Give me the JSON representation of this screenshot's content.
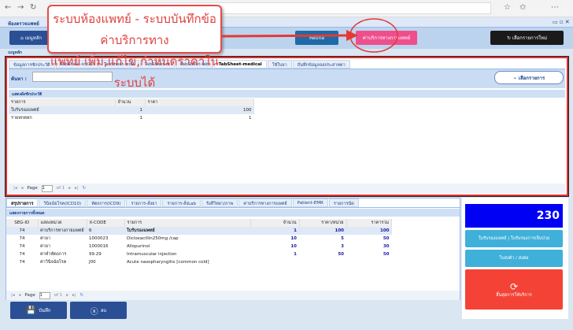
{
  "app": {
    "title": "ห้องตรวจแพทย์"
  },
  "toolbar": {
    "home": "เมนูหลัก",
    "retina": "Retina",
    "medical_fee": "ค่าบริการทางการแพทย์",
    "new_item": "เลือกรายการใหม่"
  },
  "menu_tab": "เมนูหลัก",
  "callout": {
    "line1": "ระบบห้องแพทย์ - ระบบบันทึกข้อค่าบริการทาง",
    "line2": "แพทย์ เพิ่ม,แก้ไข,กำหนดราคาในระบบได้"
  },
  "top_tabs": [
    "ข้อมูลการซักประวัติ",
    "TabSheet-icd10",
    "TabSheet-icd9",
    "TabSheet-rx",
    "TabSheet-lab",
    "TabSheet-medical",
    "ใช้ใบยา",
    "บันทึกข้อมูลจอประสาทตา"
  ],
  "search": {
    "label": "ค้นหา :",
    "value": "",
    "select_button": "เลือกรายการ"
  },
  "upper_grid": {
    "title": "แสดงผังซักประวัติ",
    "columns": [
      "รายการ",
      "จำนวน",
      "ราคา"
    ],
    "rows": [
      [
        "ใบรับรองแพทย์",
        "1",
        "100"
      ],
      [
        "รายหกตหก",
        "1",
        "1"
      ]
    ]
  },
  "pager": {
    "page_label": "Page",
    "page": "1",
    "of": "of 1"
  },
  "bottom_tabs": [
    "สรุปรายการ",
    "วินิจฉัยโรค(ICD10)",
    "หัตถการ(ICD9)",
    "รายการ-สั่งยา",
    "รายการ-สั่งLab",
    "รังสีวิทยา/ภาพ",
    "ค่าบริการทางการแพทย์",
    "Patient-EMR",
    "รายการนัด"
  ],
  "lower_grid": {
    "title": "แสดงรายการทั้งหมด",
    "columns": [
      "SEG-ID",
      "แสดงหมวด",
      "X-CODE",
      "รายการ",
      "จำนวน",
      "ราคา/หน่วย",
      "ราคารวม"
    ],
    "rows": [
      [
        "74",
        "ค่าบริการทางกายแพทย์",
        "6",
        "ใบรับรองแพทย์",
        "1",
        "100",
        "100"
      ],
      [
        "74",
        "ค่ายา",
        "1000023",
        "Dicloxacillin250mg /cap",
        "10",
        "5",
        "50"
      ],
      [
        "74",
        "ค่ายา",
        "1000016",
        "Allopurinol",
        "10",
        "3",
        "30"
      ],
      [
        "74",
        "ค่าทำหัตถการ",
        "99.29",
        "Intramuscular injection",
        "1",
        "50",
        "50"
      ],
      [
        "74",
        "ค่าวินิจฉัยโรค",
        "J00",
        "Acute nasopharyngitis [common cold]",
        "",
        "",
        ""
      ]
    ]
  },
  "bottom_buttons": {
    "save": "บันทึก",
    "delete": "ลบ"
  },
  "right_panel": {
    "total": "230",
    "certificate": "ใบรับรองแพทย์ | ใบรับรองการเจ็บป่วย",
    "referral": "ใบส่งตัว / ส่งต่อ",
    "finish": "สิ้นสุดการให้บริการ"
  }
}
